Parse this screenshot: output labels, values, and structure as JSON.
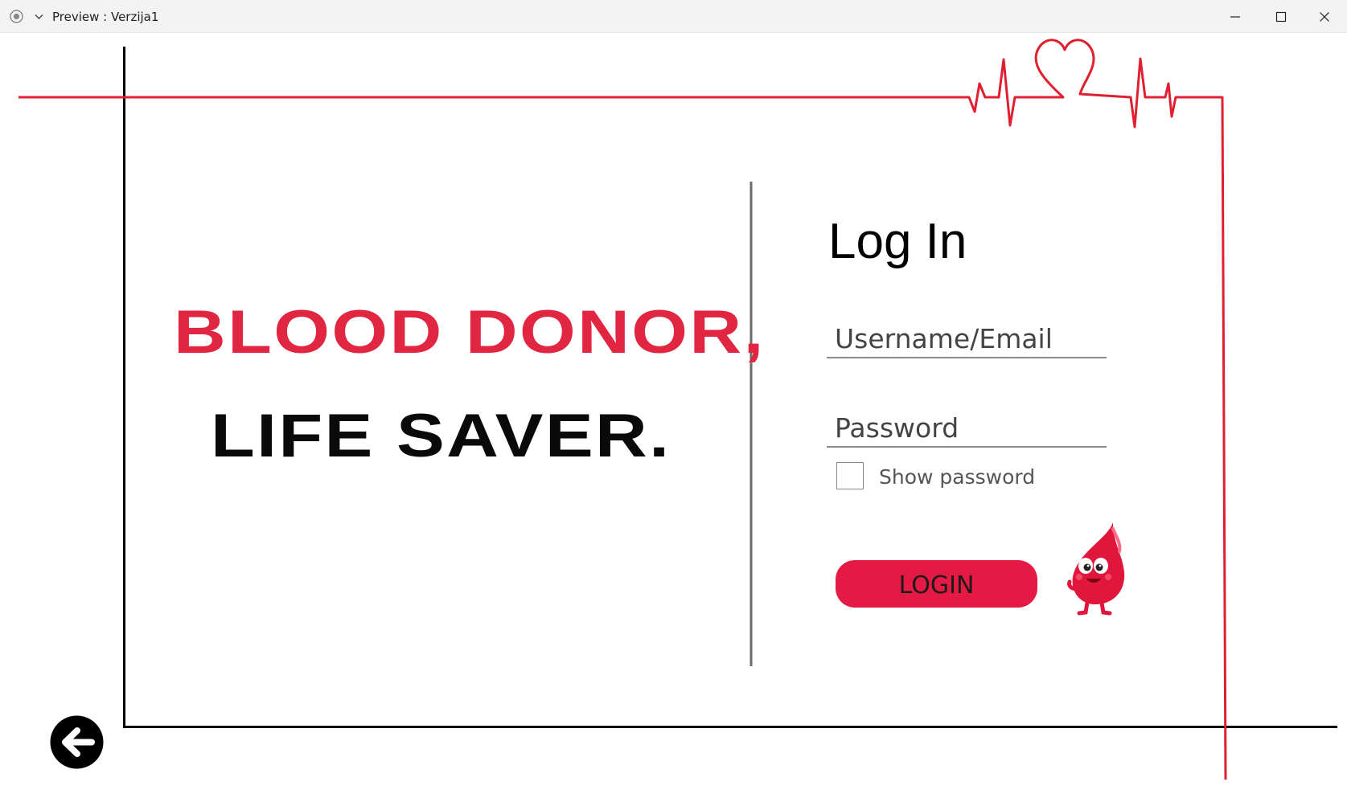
{
  "window": {
    "title": "Preview : Verzija1"
  },
  "slogan": {
    "line1": "BLOOD DONOR,",
    "line2": "LIFE SAVER."
  },
  "login": {
    "title": "Log In",
    "username_placeholder": "Username/Email",
    "password_placeholder": "Password",
    "show_password_label": "Show password",
    "show_password_checked": false,
    "button_label": "LOGIN"
  },
  "icons": {
    "app": "record-icon",
    "dropdown": "chevron-down-icon",
    "minimize": "minimize-icon",
    "maximize": "maximize-icon",
    "close": "close-icon",
    "back": "arrow-left-circle-icon",
    "mascot": "blood-drop-mascot",
    "heartbeat": "heartbeat-heart-icon"
  },
  "colors": {
    "accent_red": "#e02641",
    "button_red": "#e51a44",
    "line_red": "#e02030",
    "text_black": "#0a0a0a"
  }
}
